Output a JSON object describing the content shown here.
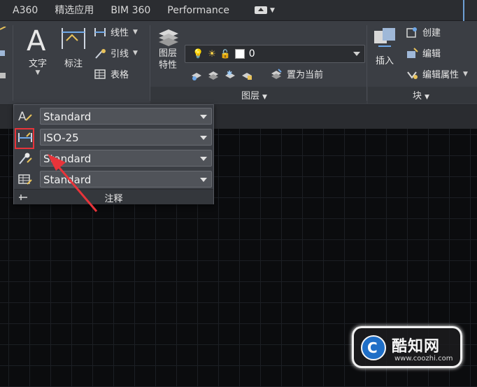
{
  "menu": {
    "tabs": [
      "A360",
      "精选应用",
      "BIM 360",
      "Performance"
    ],
    "extra_icon": "cloud-connect-icon"
  },
  "ribbon": {
    "annotation": {
      "text_label": "文字",
      "dimension_label": "标注",
      "leader_label": "引线",
      "linear_label": "线性",
      "table_label": "表格"
    },
    "layers": {
      "properties_label": "图层\n特性",
      "current_layer": "0",
      "set_current_label": "置为当前",
      "match_layer_label": "匹配图层",
      "panel_title": "图层"
    },
    "block": {
      "insert_label": "插入",
      "create_label": "创建",
      "edit_label": "编辑",
      "edit_attr_label": "编辑属性",
      "panel_title": "块"
    }
  },
  "annotation_panel": {
    "title": "注释",
    "rows": [
      {
        "icon": "text-style-icon",
        "value": "Standard"
      },
      {
        "icon": "dimension-style-icon",
        "value": "ISO-25"
      },
      {
        "icon": "multileader-style-icon",
        "value": "Standard"
      },
      {
        "icon": "table-style-icon",
        "value": "Standard"
      }
    ]
  },
  "watermark": {
    "logo_letter": "C",
    "name": "酷知网",
    "url": "www.coozhi.com"
  },
  "colors": {
    "highlight": "#e8343a",
    "arrow": "#e8343a",
    "ribbon": "#3b3e44",
    "canvas": "#0b0c0e"
  }
}
